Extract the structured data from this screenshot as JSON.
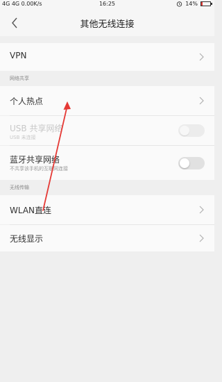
{
  "status_bar": {
    "left": "4G 4G 0.00K/s",
    "time": "16:25",
    "battery": "14%",
    "battery_level": 0.14,
    "alarm_icon": "alarm-icon"
  },
  "header": {
    "title": "其他无线连接",
    "back_icon": "back-arrow-icon"
  },
  "vpn": {
    "label": "VPN"
  },
  "sharing": {
    "section_title": "网络共享",
    "hotspot": {
      "label": "个人热点"
    },
    "usb": {
      "label": "USB 共享网络",
      "sub": "USB 未连接",
      "enabled": false
    },
    "bluetooth": {
      "label": "蓝牙共享网络",
      "sub": "不共享该手机的互联网连接",
      "on": false
    }
  },
  "wireless": {
    "section_title": "无线传输",
    "wlan_direct": {
      "label": "WLAN直连"
    },
    "wireless_display": {
      "label": "无线显示"
    }
  },
  "annotation": {
    "color": "#e53935"
  }
}
